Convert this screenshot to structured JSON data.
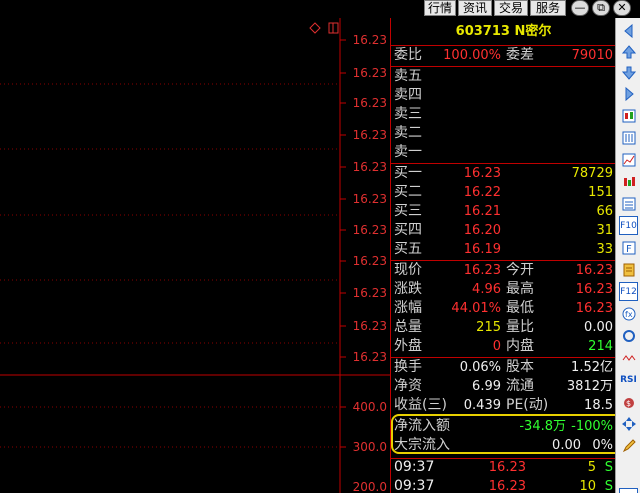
{
  "menu": {
    "items": [
      "行情",
      "资讯",
      "交易",
      "服务"
    ]
  },
  "window_controls": {
    "minimize": "—",
    "restore": "⧉",
    "close": "✕"
  },
  "chart": {
    "price_labels": [
      "16.23",
      "16.23",
      "16.23",
      "16.23",
      "16.23",
      "16.23",
      "16.23",
      "16.23",
      "16.23",
      "16.23",
      "16.23"
    ],
    "volume_labels": [
      "400.0",
      "300.0",
      "200.0"
    ],
    "line_color": "#c00000"
  },
  "quote": {
    "code_name": "603713 N密尔",
    "wei_bi_label": "委比",
    "wei_bi": "100.00%",
    "wei_cha_label": "委差",
    "wei_cha": "79010",
    "sell": [
      {
        "label": "卖五",
        "price": "",
        "vol": ""
      },
      {
        "label": "卖四",
        "price": "",
        "vol": ""
      },
      {
        "label": "卖三",
        "price": "",
        "vol": ""
      },
      {
        "label": "卖二",
        "price": "",
        "vol": ""
      },
      {
        "label": "卖一",
        "price": "",
        "vol": ""
      }
    ],
    "buy": [
      {
        "label": "买一",
        "price": "16.23",
        "vol": "78729"
      },
      {
        "label": "买二",
        "price": "16.22",
        "vol": "151"
      },
      {
        "label": "买三",
        "price": "16.21",
        "vol": "66"
      },
      {
        "label": "买四",
        "price": "16.20",
        "vol": "31"
      },
      {
        "label": "买五",
        "price": "16.19",
        "vol": "33"
      }
    ],
    "stats": [
      {
        "l1": "现价",
        "v1": "16.23",
        "l2": "今开",
        "v2": "16.23"
      },
      {
        "l1": "涨跌",
        "v1": "4.96",
        "l2": "最高",
        "v2": "16.23"
      },
      {
        "l1": "涨幅",
        "v1": "44.01%",
        "l2": "最低",
        "v2": "16.23"
      },
      {
        "l1": "总量",
        "v1": "215",
        "l2": "量比",
        "v2": "0.00"
      },
      {
        "l1": "外盘",
        "v1": "0",
        "l2": "内盘",
        "v2": "214"
      }
    ],
    "stats2": [
      {
        "l1": "换手",
        "v1": "0.06%",
        "l2": "股本",
        "v2": "1.52亿"
      },
      {
        "l1": "净资",
        "v1": "6.99",
        "l2": "流通",
        "v2": "3812万"
      },
      {
        "l1": "收益(三)",
        "v1": "0.439",
        "l2": "PE(动)",
        "v2": "18.5"
      }
    ],
    "net_inflow_label": "净流入额",
    "net_inflow": "-34.8万",
    "net_inflow_pct": "-100%",
    "block_inflow_label": "大宗流入",
    "block_inflow": "0.00",
    "block_inflow_pct": "0%",
    "ticks": [
      {
        "time": "09:37",
        "price": "16.23",
        "vol": "5",
        "dir": "S"
      },
      {
        "time": "09:37",
        "price": "16.23",
        "vol": "10",
        "dir": "S"
      }
    ]
  },
  "toolbar_icons": [
    "arrow-left-icon",
    "arrow-up-icon",
    "arrow-down-icon",
    "arrow-right-icon",
    "k-line-icon",
    "bar-chart-icon",
    "line-chart-icon",
    "candle-icon",
    "list-icon",
    "f10-icon",
    "f-icon",
    "news-icon",
    "f12-icon",
    "formula-icon",
    "circle-icon",
    "wave-icon",
    "rsi-icon",
    "money-icon",
    "move-icon",
    "pen-icon",
    "f5-icon"
  ],
  "toolbar_labels": {
    "f10": "F10",
    "f12": "F12",
    "rsi": "RSI",
    "f5": "F5"
  }
}
